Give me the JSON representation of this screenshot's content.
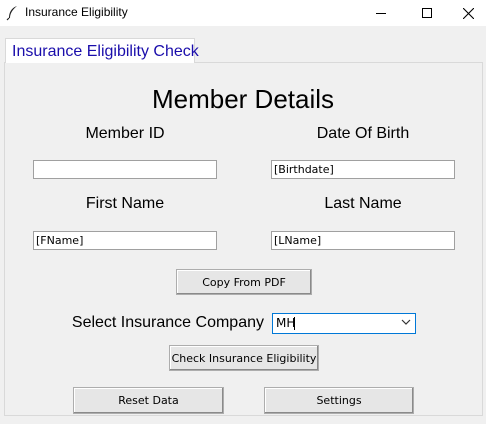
{
  "window": {
    "title": "Insurance Eligibility"
  },
  "tabs": [
    {
      "label": "Insurance Eligibility Check"
    }
  ],
  "form": {
    "heading": "Member Details",
    "member_id": {
      "label": "Member ID",
      "value": ""
    },
    "dob": {
      "label": "Date Of Birth",
      "value": "[Birthdate]"
    },
    "first_name": {
      "label": "First Name",
      "value": "[FName]"
    },
    "last_name": {
      "label": "Last Name",
      "value": "[LName]"
    },
    "copy_button": "Copy From PDF",
    "insurance_label": "Select Insurance Company",
    "insurance_selected": "MH",
    "check_button": "Check Insurance Eligibility",
    "reset_button": "Reset Data",
    "settings_button": "Settings"
  },
  "icons": {
    "app": "feather-icon",
    "minimize": "minimize-icon",
    "maximize": "maximize-icon",
    "close": "close-icon",
    "dropdown": "chevron-down-icon"
  },
  "colors": {
    "tab_text": "#1a0dab",
    "combo_border": "#0078d7",
    "background": "#f0f0f0"
  }
}
